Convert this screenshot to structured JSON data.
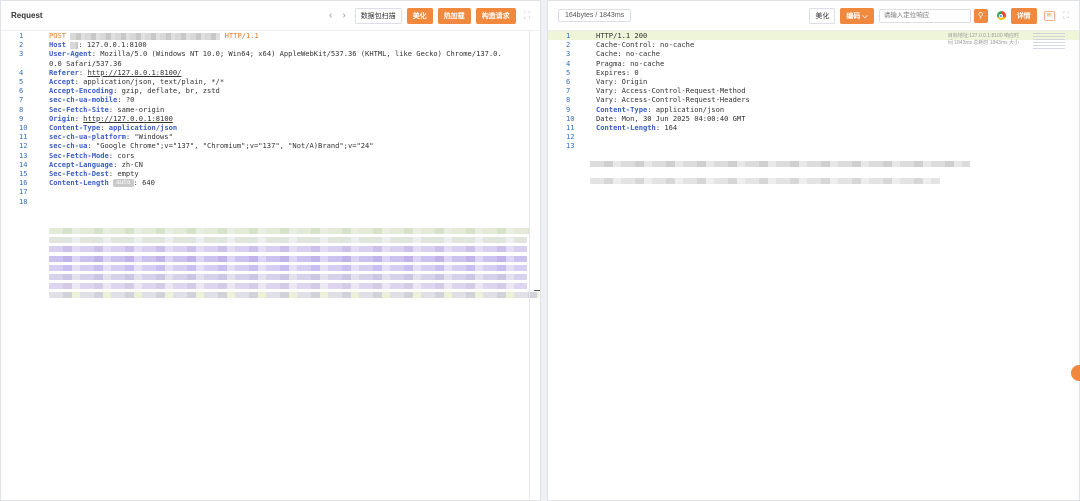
{
  "left": {
    "title": "Request",
    "prev_icon": "chevron-left-icon",
    "next_icon": "chevron-right-icon",
    "buttons": {
      "scan": "数据包扫描",
      "beautify": "美化",
      "hot_load": "热加载",
      "build": "构造请求"
    },
    "expand_icon": "expand-icon",
    "lines": [
      {
        "n": "1",
        "parts": [
          {
            "t": "POST",
            "c": "method"
          },
          {
            "t": " ",
            "c": ""
          },
          {
            "mask": 150
          },
          {
            "t": " HTTP/1.1",
            "c": "method"
          }
        ]
      },
      {
        "n": "2",
        "parts": [
          {
            "t": "Host",
            "c": "key"
          },
          {
            "t": " ",
            "c": ""
          },
          {
            "mask": 8
          },
          {
            "t": ": 127.0.0.1:8100",
            "c": ""
          }
        ]
      },
      {
        "n": "3",
        "parts": [
          {
            "t": "User-Agent",
            "c": "key"
          },
          {
            "t": ": Mozilla/5.0 (Windows NT 10.0; Win64; x64) AppleWebKit/537.36 (KHTML, like Gecko) Chrome/137.0.",
            "c": ""
          }
        ]
      },
      {
        "n": "",
        "parts": [
          {
            "t": "0.0 Safari/537.36",
            "c": ""
          }
        ]
      },
      {
        "n": "4",
        "parts": [
          {
            "t": "Referer",
            "c": "key"
          },
          {
            "t": ": ",
            "c": ""
          },
          {
            "t": "http://127.0.0.1:8100/",
            "c": "uline"
          }
        ]
      },
      {
        "n": "5",
        "parts": [
          {
            "t": "Accept",
            "c": "key"
          },
          {
            "t": ": application/json, text/plain, */*",
            "c": ""
          }
        ]
      },
      {
        "n": "6",
        "parts": [
          {
            "t": "Accept-Encoding",
            "c": "key"
          },
          {
            "t": ": gzip, deflate, br, zstd",
            "c": ""
          }
        ]
      },
      {
        "n": "7",
        "parts": [
          {
            "t": "sec-ch-ua-mobile",
            "c": "key"
          },
          {
            "t": ": ?0",
            "c": ""
          }
        ]
      },
      {
        "n": "8",
        "parts": [
          {
            "t": "Sec-Fetch-Site",
            "c": "key"
          },
          {
            "t": ": same-origin",
            "c": ""
          }
        ]
      },
      {
        "n": "9",
        "parts": [
          {
            "t": "Origin",
            "c": "key"
          },
          {
            "t": ": ",
            "c": ""
          },
          {
            "t": "http://127.0.0.1:8100",
            "c": "uline"
          }
        ]
      },
      {
        "n": "10",
        "parts": [
          {
            "t": "Content-Type",
            "c": "key"
          },
          {
            "t": ": ",
            "c": ""
          },
          {
            "t": "application/json",
            "c": "key"
          }
        ]
      },
      {
        "n": "11",
        "parts": [
          {
            "t": "sec-ch-ua-platform",
            "c": "key"
          },
          {
            "t": ": \"Windows\"",
            "c": ""
          }
        ]
      },
      {
        "n": "12",
        "parts": [
          {
            "t": "sec-ch-ua",
            "c": "key"
          },
          {
            "t": ": \"Google Chrome\";v=\"137\", \"Chromium\";v=\"137\", \"Not/A)Brand\";v=\"24\"",
            "c": ""
          }
        ]
      },
      {
        "n": "13",
        "parts": [
          {
            "t": "Sec-Fetch-Mode",
            "c": "key"
          },
          {
            "t": ": cors",
            "c": ""
          }
        ]
      },
      {
        "n": "14",
        "parts": [
          {
            "t": "Accept-Language",
            "c": "key"
          },
          {
            "t": ": zh-CN",
            "c": ""
          }
        ]
      },
      {
        "n": "15",
        "parts": [
          {
            "t": "Sec-Fetch-Dest",
            "c": "key"
          },
          {
            "t": ": empty",
            "c": ""
          }
        ]
      },
      {
        "n": "16",
        "parts": [
          {
            "t": "Content-Length",
            "c": "key"
          },
          {
            "t": " ",
            "c": ""
          },
          {
            "badge": "auto"
          },
          {
            "t": ": 640",
            "c": ""
          }
        ]
      },
      {
        "n": "17",
        "parts": []
      },
      {
        "n": "18",
        "parts": []
      }
    ],
    "body_rows": [
      {
        "w": 480,
        "cols": [
          "#e3ead8",
          "#d6e2c9",
          "#e9eee3"
        ]
      },
      {
        "w": 478,
        "cols": [
          "#e1e6dd",
          "#dfe6e0",
          "#eceef0"
        ]
      },
      {
        "w": 478,
        "cols": [
          "#d8d0f0",
          "#cbc2ec",
          "#e2dcf5"
        ]
      },
      {
        "w": 478,
        "cols": [
          "#ccc2f0",
          "#bfb3ea",
          "#ddd5f5"
        ]
      },
      {
        "w": 478,
        "cols": [
          "#d6cff2",
          "#c8bff0",
          "#e6e0f7"
        ]
      },
      {
        "w": 478,
        "cols": [
          "#d7d2eb",
          "#cbc6e3",
          "#e4e1ef"
        ]
      },
      {
        "w": 478,
        "cols": [
          "#ded6f0",
          "#d3cbe8",
          "#ebe7f3"
        ]
      },
      {
        "w": 490,
        "cols": [
          "#e0e0e6",
          "#d2d2db",
          "#ecf1d8"
        ]
      }
    ]
  },
  "right": {
    "info": "164bytes / 1843ms",
    "beautify": "美化",
    "encoding": "编码",
    "encoding_icon": "chevron-down-icon",
    "search_placeholder": "请输入定位响应",
    "search_icon": "search-icon",
    "chrome_icon": "chrome-icon",
    "details": "详情",
    "chat_icon": "chat-icon",
    "expand_icon": "expand-icon",
    "lines": [
      {
        "n": "1",
        "hl": true,
        "parts": [
          {
            "t": "HTTP/1.1 200",
            "c": ""
          }
        ]
      },
      {
        "n": "2",
        "parts": [
          {
            "t": "Cache-Control: no-cache",
            "c": ""
          }
        ]
      },
      {
        "n": "3",
        "parts": [
          {
            "t": "Cache: no-cache",
            "c": ""
          }
        ]
      },
      {
        "n": "4",
        "parts": [
          {
            "t": "Pragma: no-cache",
            "c": ""
          }
        ]
      },
      {
        "n": "5",
        "parts": [
          {
            "t": "Expires: 0",
            "c": ""
          }
        ]
      },
      {
        "n": "6",
        "parts": [
          {
            "t": "Vary: Origin",
            "c": ""
          }
        ]
      },
      {
        "n": "7",
        "parts": [
          {
            "t": "Vary: Access-Control-Request-Method",
            "c": ""
          }
        ]
      },
      {
        "n": "8",
        "parts": [
          {
            "t": "Vary: Access-Control-Request-Headers",
            "c": ""
          }
        ]
      },
      {
        "n": "9",
        "parts": [
          {
            "t": "Content-Type",
            "c": "key"
          },
          {
            "t": ": application/json",
            "c": ""
          }
        ]
      },
      {
        "n": "10",
        "parts": [
          {
            "t": "Date: Mon, 30 Jun 2025 04:00:40 GMT",
            "c": ""
          }
        ]
      },
      {
        "n": "11",
        "parts": [
          {
            "t": "Content-Length",
            "c": "key"
          },
          {
            "t": ": 164",
            "c": ""
          }
        ]
      },
      {
        "n": "12",
        "parts": []
      },
      {
        "n": "13",
        "parts": []
      }
    ],
    "meta": {
      "line1": "目标地址:127.0.0.1:8100  响应时",
      "line2": "间 1843ms  总耗时 1843ms  大小"
    },
    "body_rows": [
      {
        "w": 380,
        "cols": [
          "#dcdcdc",
          "#cfcfcf",
          "#e8e8e8"
        ]
      },
      {
        "w": 350,
        "cols": [
          "#e4e4e4",
          "#d7d7d7",
          "#eeeeee"
        ]
      }
    ]
  }
}
